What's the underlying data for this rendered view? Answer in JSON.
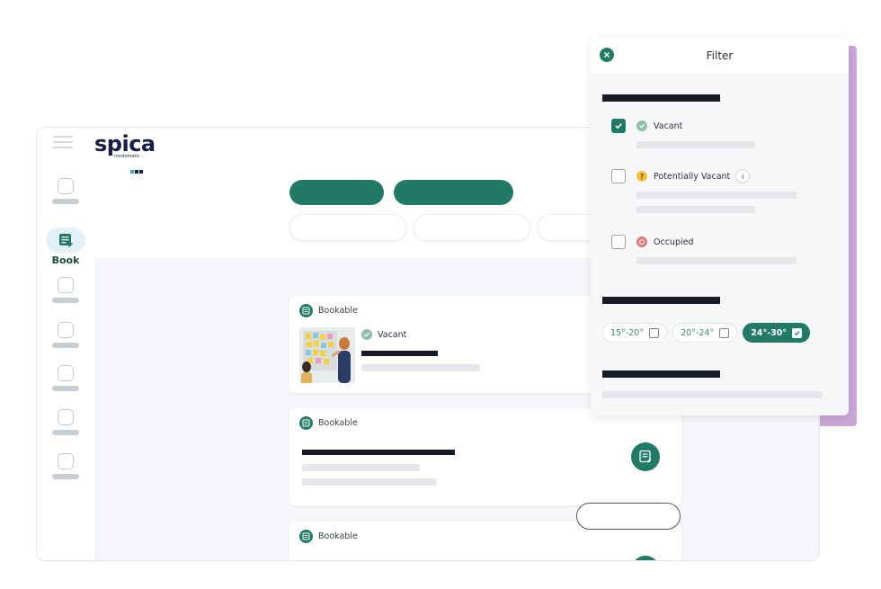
{
  "app": {
    "logo_text": "spica",
    "logo_subtext": "nordomatic",
    "nav": {
      "book_label": "Book"
    }
  },
  "cards": [
    {
      "tag": "Bookable",
      "status": "Vacant"
    },
    {
      "tag": "Bookable"
    },
    {
      "tag": "Bookable"
    }
  ],
  "filter": {
    "title": "Filter",
    "options": [
      {
        "label": "Vacant",
        "checked": true,
        "status_color": "#8fbfa9",
        "icon": "check-icon"
      },
      {
        "label": "Potentially Vacant",
        "checked": false,
        "status_color": "#f3c042",
        "icon": "question-icon",
        "info": "i"
      },
      {
        "label": "Occupied",
        "checked": false,
        "status_color": "#dc7c73",
        "icon": "no-entry-icon"
      }
    ],
    "temperatures": [
      {
        "label": "15°-20°",
        "checked": false
      },
      {
        "label": "20°-24°",
        "checked": false
      },
      {
        "label": "24°-30°",
        "checked": true
      }
    ]
  },
  "colors": {
    "accent": "#207a66",
    "logo": "#171d48",
    "panel_shadow": "#c8a6d6"
  }
}
